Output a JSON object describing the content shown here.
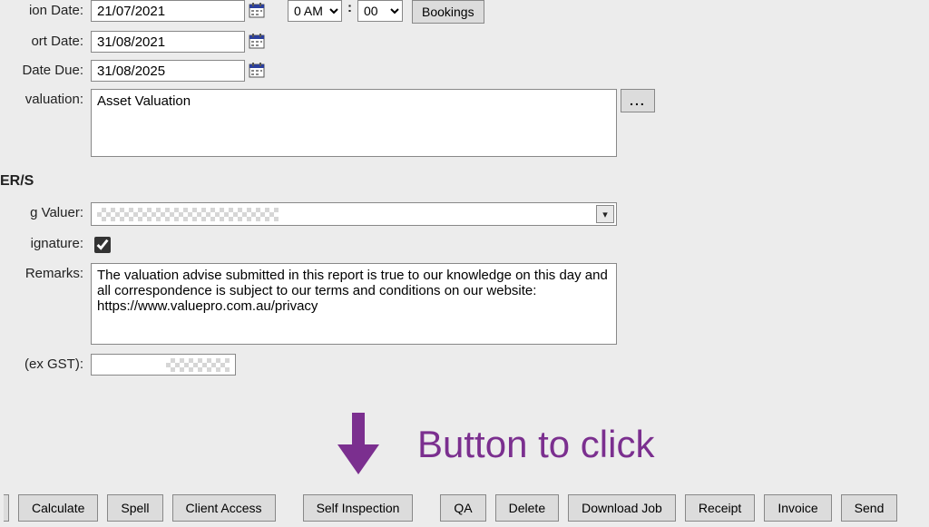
{
  "fields": {
    "inspection_date": {
      "label": "ion Date:",
      "value": "21/07/2021"
    },
    "report_date": {
      "label": "ort Date:",
      "value": "31/08/2021"
    },
    "date_due": {
      "label": "Date Due:",
      "value": "31/08/2025"
    },
    "time": {
      "ampm": "0 AM",
      "minutes": "00"
    },
    "valuation": {
      "label": "valuation:",
      "value": "Asset Valuation"
    },
    "bookings_btn": "Bookings",
    "dots_btn": "..."
  },
  "valuer_section": {
    "heading": "ER/S",
    "valuer_label": "g Valuer:",
    "signature_label": "ignature:",
    "signature_checked": true,
    "remarks_label": "Remarks:",
    "remarks_value": "The valuation advise submitted in this report is true to our knowledge on this day and all correspondence is subject to our terms and conditions on our website: https://www.valuepro.com.au/privacy",
    "gst_label": "(ex GST):"
  },
  "annotation": {
    "text": "Button to click",
    "color": "#7b2f8f"
  },
  "buttons": {
    "calculate": "Calculate",
    "spell": "Spell",
    "client_access": "Client Access",
    "self_inspection": "Self Inspection",
    "qa": "QA",
    "delete": "Delete",
    "download_job": "Download Job",
    "receipt": "Receipt",
    "invoice": "Invoice",
    "send": "Send"
  }
}
